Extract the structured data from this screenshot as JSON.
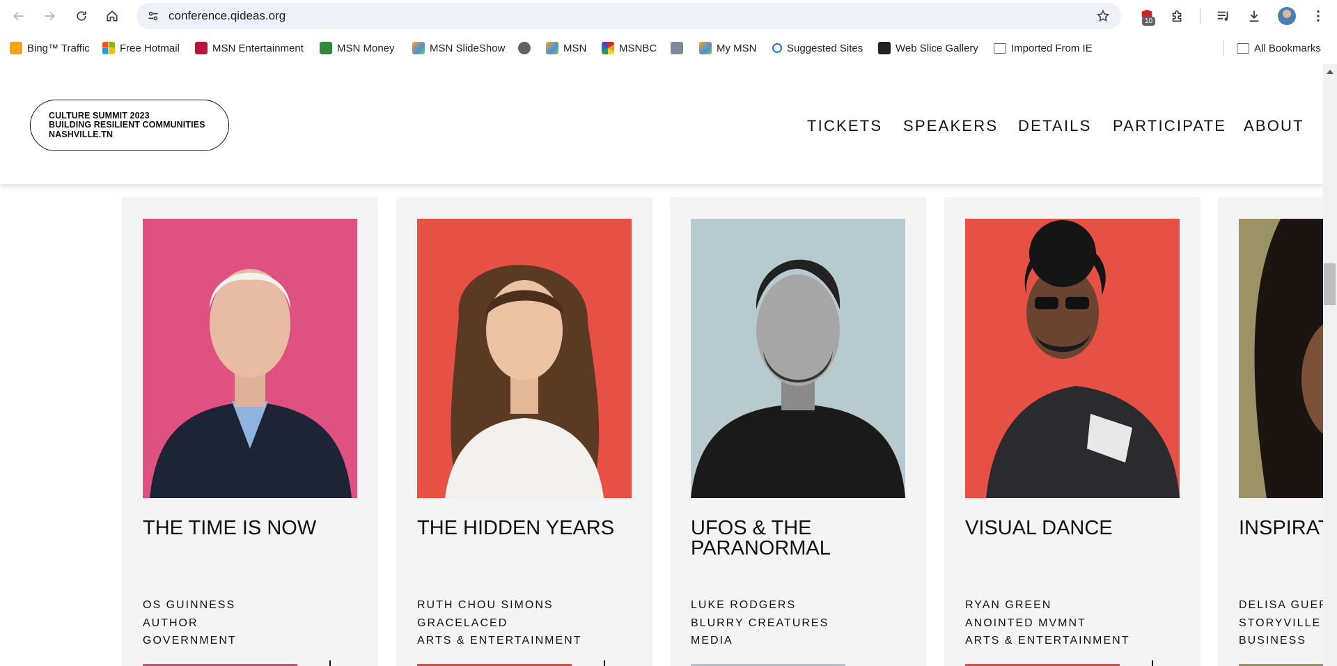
{
  "browser": {
    "url": "conference.qideas.org",
    "extension_badge": "10",
    "bookmarks": [
      {
        "label": "Bing™ Traffic",
        "icon": "bing-icon"
      },
      {
        "label": "Free Hotmail",
        "icon": "windows-icon"
      },
      {
        "label": "MSN Entertainment",
        "icon": "msn-entertainment-icon"
      },
      {
        "label": "MSN Money",
        "icon": "msn-money-icon"
      },
      {
        "label": "MSN SlideShow",
        "icon": "msn-butterfly-icon"
      },
      {
        "label": "",
        "icon": "globe-icon"
      },
      {
        "label": "MSN",
        "icon": "msn-butterfly-icon"
      },
      {
        "label": "MSNBC",
        "icon": "nbc-peacock-icon"
      },
      {
        "label": "",
        "icon": "generic-page-icon"
      },
      {
        "label": "My MSN",
        "icon": "msn-butterfly-icon"
      },
      {
        "label": "Suggested Sites",
        "icon": "search-icon"
      },
      {
        "label": "Web Slice Gallery",
        "icon": "web-slice-icon"
      },
      {
        "label": "Imported From IE",
        "icon": "folder-icon"
      }
    ],
    "all_bookmarks": "All Bookmarks"
  },
  "site": {
    "logo_lines": [
      "CULTURE SUMMIT 2023",
      "BUILDING RESILIENT COMMUNITIES",
      "NASHVILLE.TN"
    ],
    "nav": [
      "TICKETS",
      "SPEAKERS",
      "DETAILS",
      "PARTICIPATE",
      "ABOUT"
    ]
  },
  "speakers": [
    {
      "talk": "THE TIME IS NOW",
      "name": "OS GUINNESS",
      "org": "AUTHOR",
      "category": "GOVERNMENT",
      "bg_color": "#de5180",
      "accent": "#c94f75",
      "show_plus": true
    },
    {
      "talk": "THE HIDDEN YEARS",
      "name": "RUTH CHOU SIMONS",
      "org": "GRACELACED",
      "category": "ARTS & ENTERTAINMENT",
      "bg_color": "#e65045",
      "accent": "#e24a3f",
      "show_plus": true
    },
    {
      "talk": "UFOS & THE PARANORMAL",
      "name": "LUKE RODGERS",
      "org": "BLURRY CREATURES",
      "category": "MEDIA",
      "bg_color": "#b7cbce",
      "accent": "#aec3c7",
      "show_plus": false
    },
    {
      "talk": "VISUAL DANCE",
      "name": "RYAN GREEN",
      "org": "ANOINTED MVMNT",
      "category": "ARTS & ENTERTAINMENT",
      "bg_color": "#e65045",
      "accent": "#e24a3f",
      "show_plus": true
    },
    {
      "talk": "INSPIRAT STORYV",
      "name": "DELISA GUER",
      "org": "STORYVILLE C",
      "category": "BUSINESS",
      "bg_color": "#9b9366",
      "accent": "#9b9366",
      "show_plus": false
    }
  ]
}
